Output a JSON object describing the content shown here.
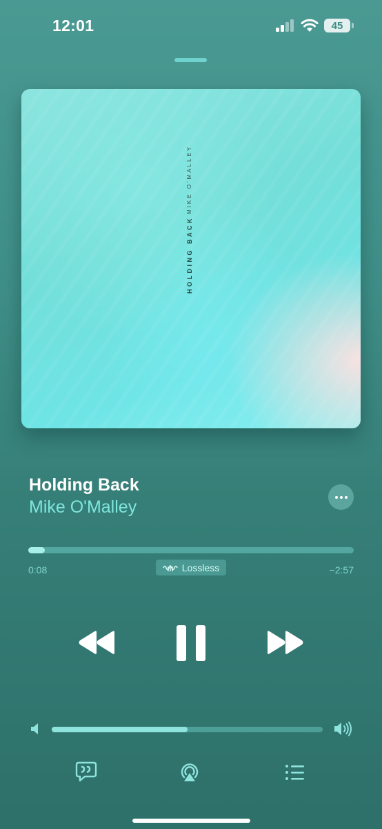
{
  "status_bar": {
    "time": "12:01",
    "battery_level": "45",
    "icons": [
      "signal-icon",
      "wifi-icon",
      "battery-icon"
    ]
  },
  "album_art": {
    "title_text": "HOLDING BACK",
    "artist_text": "MIKE O'MALLEY"
  },
  "track": {
    "title": "Holding Back",
    "artist": "Mike O'Malley"
  },
  "playback": {
    "elapsed": "0:08",
    "remaining": "−2:57",
    "badge": "Lossless",
    "progress_fraction": 0.05,
    "volume_fraction": 0.5
  },
  "controls": [
    "rewind-icon",
    "pause-icon",
    "fast-forward-icon"
  ],
  "bottom_bar": [
    "lyrics-icon",
    "airplay-icon",
    "queue-icon"
  ],
  "colors": {
    "background": "#3f8f88",
    "accent": "#7fe6dd",
    "progress_fill": "#a8efe9"
  }
}
